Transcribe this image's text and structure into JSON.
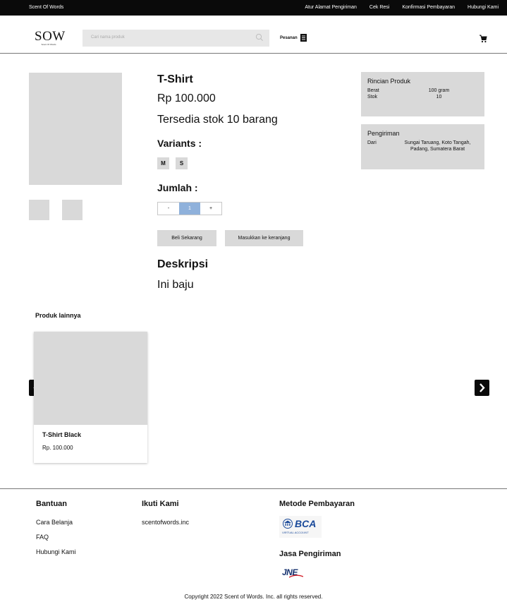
{
  "topbar": {
    "brand": "Scent Of Words",
    "links": [
      "Atur Alamat Pengiriman",
      "Cek Resi",
      "Konfirmasi Pembayaran",
      "Hubungi Kami"
    ]
  },
  "header": {
    "logo_text": "SOW",
    "logo_sub": "Scent Of Words",
    "search_placeholder": "Cari nama produk",
    "pesanan_label": "Pesanan"
  },
  "product": {
    "title": "T-Shirt",
    "price": "Rp 100.000",
    "stock": "Tersedia stok 10 barang",
    "variants_heading": "Variants :",
    "variants": [
      "M",
      "S"
    ],
    "quantity_heading": "Jumlah :",
    "qty_minus": "-",
    "qty_value": "1",
    "qty_plus": "+",
    "buy_now_label": "Beli Sekarang",
    "add_to_cart_label": "Masukkan ke keranjang",
    "description_heading": "Deskripsi",
    "description": "Ini baju"
  },
  "details": {
    "title": "Rincian Produk",
    "weight_label": "Berat",
    "weight_value": "100 gram",
    "stock_label": "Stok",
    "stock_value": "10"
  },
  "shipping": {
    "title": "Pengiriman",
    "from_label": "Dari",
    "from_value": "Sungai Taruang, Koto Tangah, Padang, Sumatera Barat"
  },
  "related": {
    "heading": "Produk lainnya",
    "items": [
      {
        "name": "T-Shirt Black",
        "price": "Rp. 100.000"
      }
    ]
  },
  "footer": {
    "help_heading": "Bantuan",
    "help_links": [
      "Cara Belanja",
      "FAQ",
      "Hubungi Kami"
    ],
    "follow_heading": "Ikuti Kami",
    "follow_handle": "scentofwords.inc",
    "payment_heading": "Metode Pembayaran",
    "payment_logo_text": "BCA",
    "payment_logo_sub": "VIRTUAL ACCOUNT",
    "shipping_heading": "Jasa Pengiriman",
    "shipping_logo_text": "JNE",
    "copyright": "Copyright 2022 Scent of Words. Inc. all rights reserved."
  }
}
